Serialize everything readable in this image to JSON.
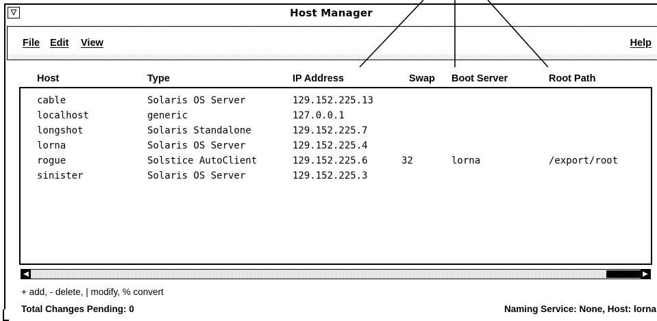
{
  "window": {
    "title": "Host Manager",
    "menu_box_glyph": "▽"
  },
  "menubar": {
    "items": [
      {
        "label": "File"
      },
      {
        "label": "Edit"
      },
      {
        "label": "View"
      }
    ],
    "help_label": "Help"
  },
  "table": {
    "columns": [
      "Host",
      "Type",
      "IP Address",
      "Swap",
      "Boot Server",
      "Root Path"
    ],
    "rows": [
      {
        "host": "cable",
        "type": "Solaris OS Server",
        "ip": "129.152.225.13",
        "swap": "",
        "boot_server": "",
        "root_path": ""
      },
      {
        "host": "localhost",
        "type": "generic",
        "ip": "127.0.0.1",
        "swap": "",
        "boot_server": "",
        "root_path": ""
      },
      {
        "host": "longshot",
        "type": "Solaris Standalone",
        "ip": "129.152.225.7",
        "swap": "",
        "boot_server": "",
        "root_path": ""
      },
      {
        "host": "lorna",
        "type": "Solaris OS Server",
        "ip": "129.152.225.4",
        "swap": "",
        "boot_server": "",
        "root_path": ""
      },
      {
        "host": "rogue",
        "type": "Solstice AutoClient",
        "ip": "129.152.225.6",
        "swap": "32",
        "boot_server": "lorna",
        "root_path": "/export/root"
      },
      {
        "host": "sinister",
        "type": "Solaris OS Server",
        "ip": "129.152.225.3",
        "swap": "",
        "boot_server": "",
        "root_path": ""
      }
    ]
  },
  "scrollbar": {
    "left_arrow": "◀",
    "right_arrow": "▶"
  },
  "status": {
    "legend": "+ add, - delete, | modify, % convert",
    "pending": "Total Changes Pending: 0",
    "naming": "Naming Service: None, Host: lorna"
  }
}
